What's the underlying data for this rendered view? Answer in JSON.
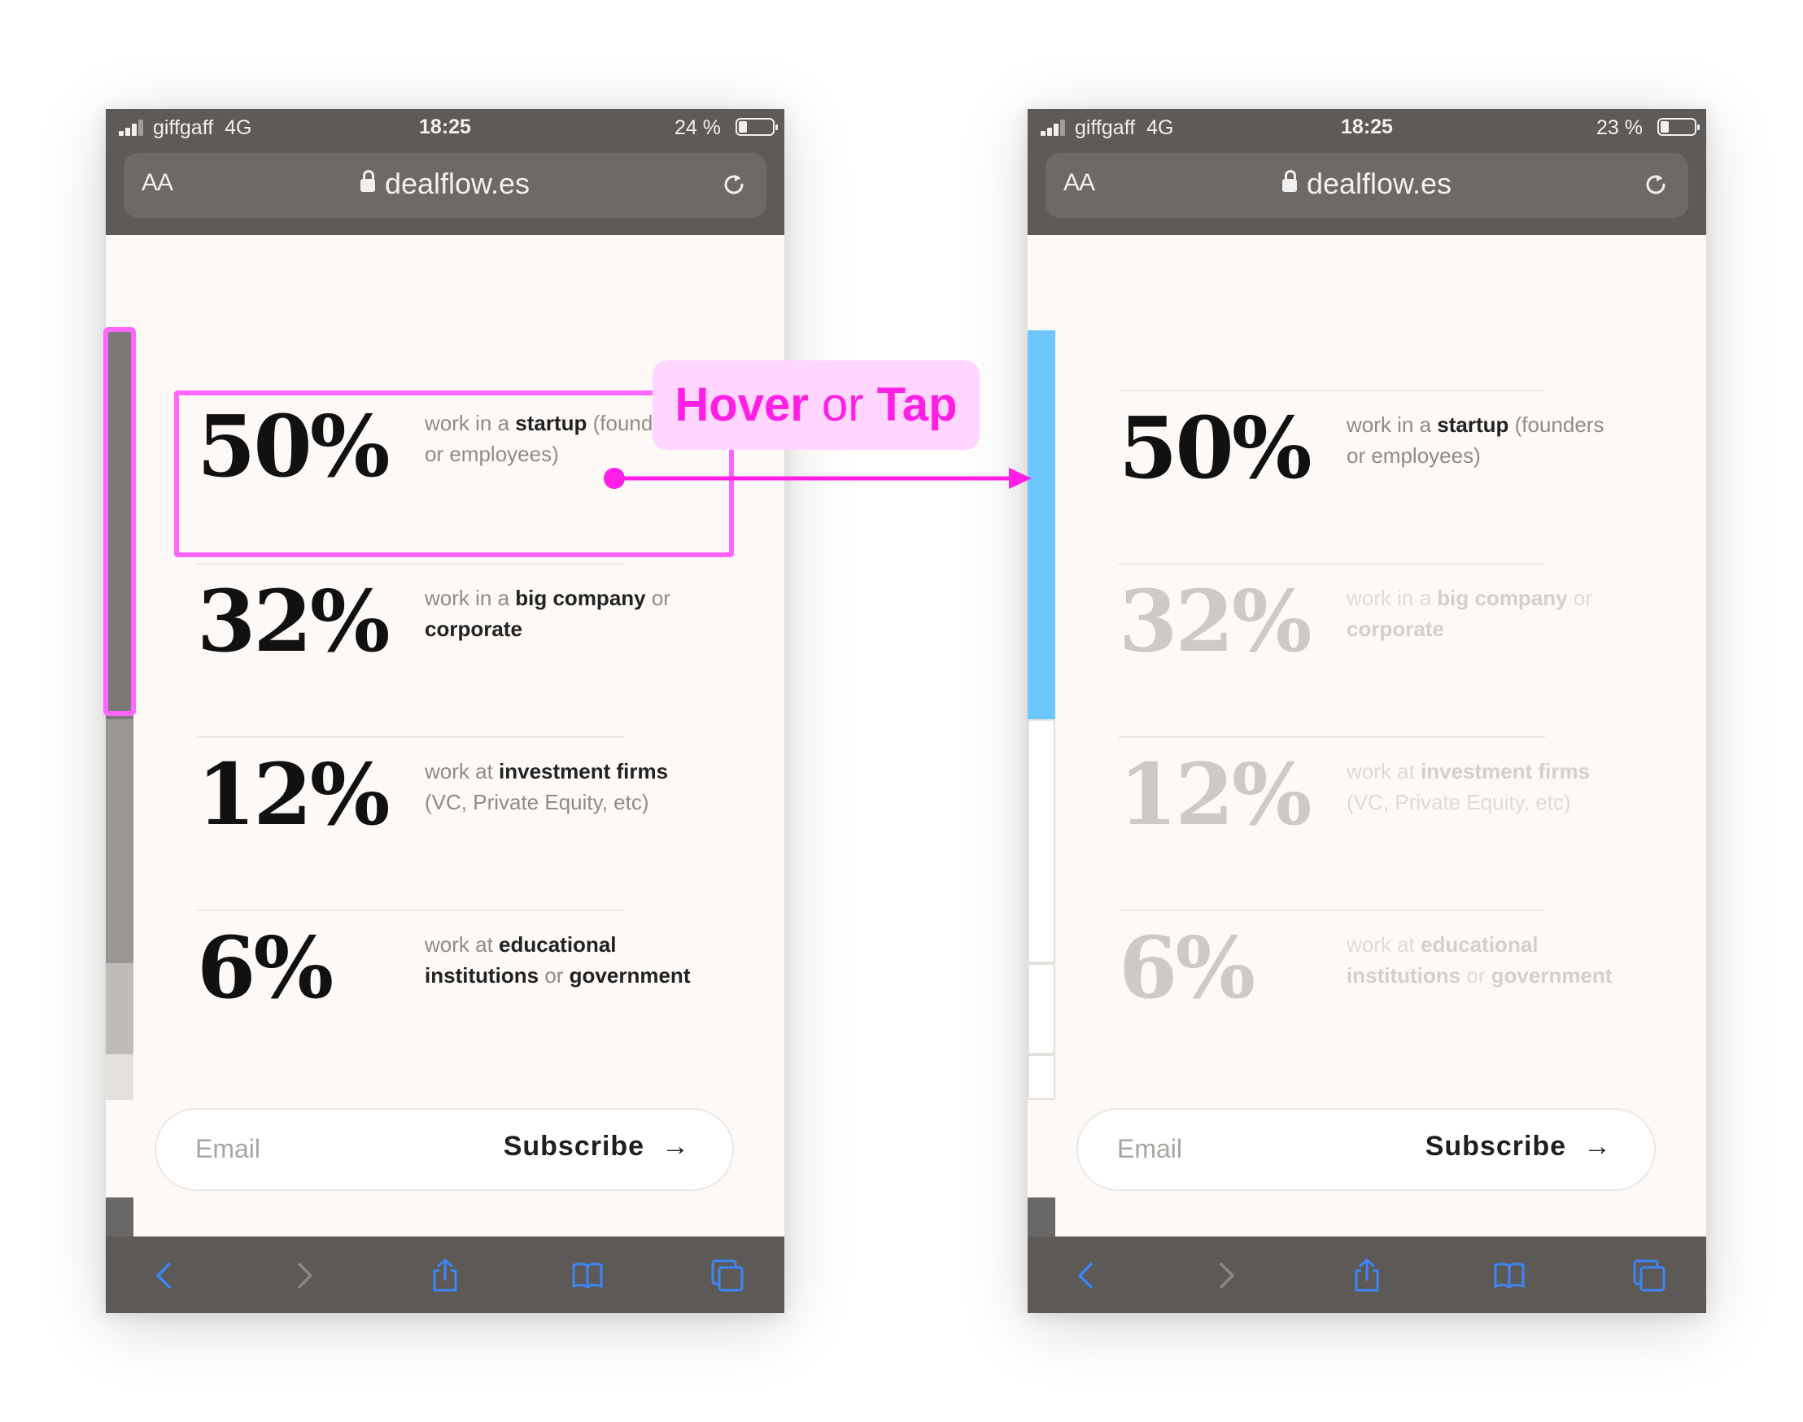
{
  "status_bar": {
    "carrier": "giffgaff",
    "network": "4G",
    "time": "18:25",
    "battery_left": "24 %",
    "battery_right": "23 %"
  },
  "browser": {
    "text_size_label": "AA",
    "url": "dealflow.es"
  },
  "stats": [
    {
      "pct": "50%",
      "pre": "work in a ",
      "bold1": "startup",
      "mid": " (founders or employees)",
      "bold2": "",
      "post": ""
    },
    {
      "pct": "32%",
      "pre": "work in a ",
      "bold1": "big company",
      "mid": " or ",
      "bold2": "corporate",
      "post": ""
    },
    {
      "pct": "12%",
      "pre": "work at ",
      "bold1": "investment firms",
      "mid": " (VC, Private Equity, etc)",
      "bold2": "",
      "post": ""
    },
    {
      "pct": "6%",
      "pre": "work at ",
      "bold1": "educational institutions",
      "mid": " or ",
      "bold2": "government",
      "post": ""
    }
  ],
  "form": {
    "email_placeholder": "Email",
    "subscribe_label": "Subscribe",
    "arrow_glyph": "→"
  },
  "annotation": {
    "hover": "Hover",
    "or": "or",
    "tap": "Tap"
  },
  "colors": {
    "highlight": "#ff66ff",
    "callout_text": "#ff1ee6",
    "active_track": "#6cc7ff",
    "browser_bar": "#5d5a58",
    "toolbar_icon": "#3c86f5"
  },
  "icons": [
    "signal-icon",
    "battery-icon",
    "lock-icon",
    "reload-icon",
    "back-icon",
    "forward-icon",
    "share-icon",
    "bookmarks-icon",
    "tabs-icon"
  ]
}
